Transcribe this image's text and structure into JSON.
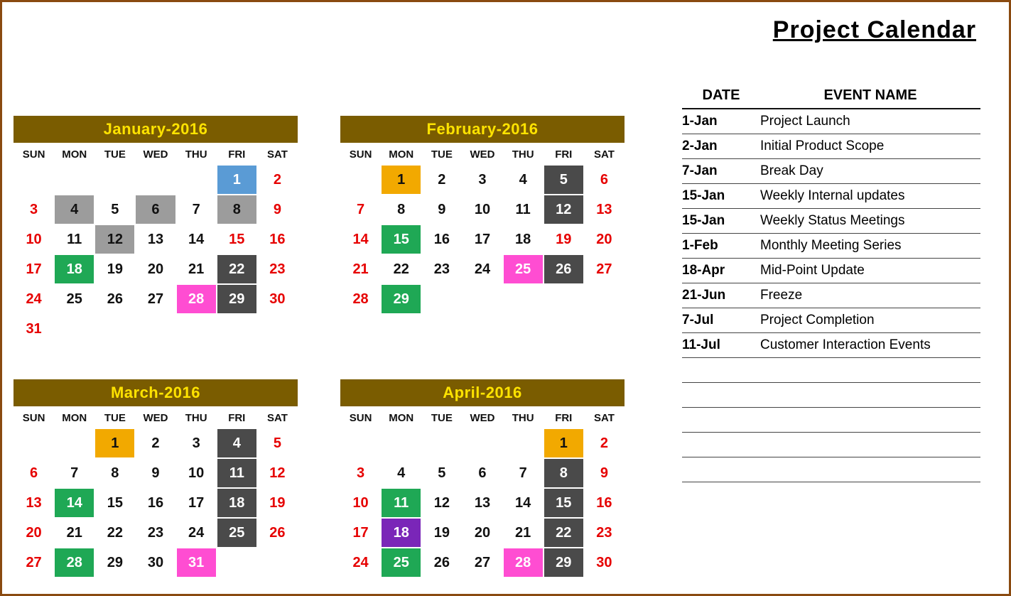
{
  "title": "Project Calendar",
  "dow": [
    "SUN",
    "MON",
    "TUE",
    "WED",
    "THU",
    "FRI",
    "SAT"
  ],
  "months": [
    {
      "title": "January-2016",
      "startDow": 5,
      "days": [
        {
          "n": 1,
          "c": "hl-blue"
        },
        {
          "n": 2,
          "c": "red"
        },
        {
          "n": 3,
          "c": "red"
        },
        {
          "n": 4,
          "c": "hl-grey"
        },
        {
          "n": 5
        },
        {
          "n": 6,
          "c": "hl-grey"
        },
        {
          "n": 7
        },
        {
          "n": 8,
          "c": "hl-grey"
        },
        {
          "n": 9,
          "c": "red"
        },
        {
          "n": 10,
          "c": "red"
        },
        {
          "n": 11
        },
        {
          "n": 12,
          "c": "hl-grey"
        },
        {
          "n": 13
        },
        {
          "n": 14
        },
        {
          "n": 15,
          "c": "red"
        },
        {
          "n": 16,
          "c": "red"
        },
        {
          "n": 17,
          "c": "red"
        },
        {
          "n": 18,
          "c": "hl-green"
        },
        {
          "n": 19
        },
        {
          "n": 20
        },
        {
          "n": 21
        },
        {
          "n": 22,
          "c": "hl-dark"
        },
        {
          "n": 23,
          "c": "red"
        },
        {
          "n": 24,
          "c": "red"
        },
        {
          "n": 25
        },
        {
          "n": 26
        },
        {
          "n": 27
        },
        {
          "n": 28,
          "c": "hl-pink"
        },
        {
          "n": 29,
          "c": "hl-dark"
        },
        {
          "n": 30,
          "c": "red"
        },
        {
          "n": 31,
          "c": "red"
        }
      ]
    },
    {
      "title": "February-2016",
      "startDow": 1,
      "days": [
        {
          "n": 1,
          "c": "hl-orange"
        },
        {
          "n": 2
        },
        {
          "n": 3
        },
        {
          "n": 4
        },
        {
          "n": 5,
          "c": "hl-dark"
        },
        {
          "n": 6,
          "c": "red"
        },
        {
          "n": 7,
          "c": "red"
        },
        {
          "n": 8
        },
        {
          "n": 9
        },
        {
          "n": 10
        },
        {
          "n": 11
        },
        {
          "n": 12,
          "c": "hl-dark"
        },
        {
          "n": 13,
          "c": "red"
        },
        {
          "n": 14,
          "c": "red"
        },
        {
          "n": 15,
          "c": "hl-green"
        },
        {
          "n": 16
        },
        {
          "n": 17
        },
        {
          "n": 18
        },
        {
          "n": 19,
          "c": "red"
        },
        {
          "n": 20,
          "c": "red"
        },
        {
          "n": 21,
          "c": "red"
        },
        {
          "n": 22
        },
        {
          "n": 23
        },
        {
          "n": 24
        },
        {
          "n": 25,
          "c": "hl-pink"
        },
        {
          "n": 26,
          "c": "hl-dark"
        },
        {
          "n": 27,
          "c": "red"
        },
        {
          "n": 28,
          "c": "red"
        },
        {
          "n": 29,
          "c": "hl-green"
        }
      ]
    },
    {
      "title": "March-2016",
      "startDow": 2,
      "days": [
        {
          "n": 1,
          "c": "hl-orange"
        },
        {
          "n": 2
        },
        {
          "n": 3
        },
        {
          "n": 4,
          "c": "hl-dark"
        },
        {
          "n": 5,
          "c": "red"
        },
        {
          "n": 6,
          "c": "red"
        },
        {
          "n": 7
        },
        {
          "n": 8
        },
        {
          "n": 9
        },
        {
          "n": 10
        },
        {
          "n": 11,
          "c": "hl-dark"
        },
        {
          "n": 12,
          "c": "red"
        },
        {
          "n": 13,
          "c": "red"
        },
        {
          "n": 14,
          "c": "hl-green"
        },
        {
          "n": 15
        },
        {
          "n": 16
        },
        {
          "n": 17
        },
        {
          "n": 18,
          "c": "hl-dark"
        },
        {
          "n": 19,
          "c": "red"
        },
        {
          "n": 20,
          "c": "red"
        },
        {
          "n": 21
        },
        {
          "n": 22
        },
        {
          "n": 23
        },
        {
          "n": 24
        },
        {
          "n": 25,
          "c": "hl-dark"
        },
        {
          "n": 26,
          "c": "red"
        },
        {
          "n": 27,
          "c": "red"
        },
        {
          "n": 28,
          "c": "hl-green"
        },
        {
          "n": 29
        },
        {
          "n": 30
        },
        {
          "n": 31,
          "c": "hl-pink"
        }
      ]
    },
    {
      "title": "April-2016",
      "startDow": 5,
      "days": [
        {
          "n": 1,
          "c": "hl-orange"
        },
        {
          "n": 2,
          "c": "red"
        },
        {
          "n": 3,
          "c": "red"
        },
        {
          "n": 4
        },
        {
          "n": 5
        },
        {
          "n": 6
        },
        {
          "n": 7
        },
        {
          "n": 8,
          "c": "hl-dark"
        },
        {
          "n": 9,
          "c": "red"
        },
        {
          "n": 10,
          "c": "red"
        },
        {
          "n": 11,
          "c": "hl-green"
        },
        {
          "n": 12
        },
        {
          "n": 13
        },
        {
          "n": 14
        },
        {
          "n": 15,
          "c": "hl-dark"
        },
        {
          "n": 16,
          "c": "red"
        },
        {
          "n": 17,
          "c": "red"
        },
        {
          "n": 18,
          "c": "hl-purple"
        },
        {
          "n": 19
        },
        {
          "n": 20
        },
        {
          "n": 21
        },
        {
          "n": 22,
          "c": "hl-dark"
        },
        {
          "n": 23,
          "c": "red"
        },
        {
          "n": 24,
          "c": "red"
        },
        {
          "n": 25,
          "c": "hl-green"
        },
        {
          "n": 26
        },
        {
          "n": 27
        },
        {
          "n": 28,
          "c": "hl-pink"
        },
        {
          "n": 29,
          "c": "hl-dark"
        },
        {
          "n": 30,
          "c": "red"
        }
      ]
    }
  ],
  "eventsHeader": {
    "date": "DATE",
    "event": "EVENT NAME"
  },
  "events": [
    {
      "date": "1-Jan",
      "name": "Project Launch"
    },
    {
      "date": "2-Jan",
      "name": "Initial Product Scope"
    },
    {
      "date": "7-Jan",
      "name": "Break Day"
    },
    {
      "date": "15-Jan",
      "name": "Weekly Internal updates"
    },
    {
      "date": "15-Jan",
      "name": "Weekly Status Meetings"
    },
    {
      "date": "1-Feb",
      "name": "Monthly Meeting Series"
    },
    {
      "date": "18-Apr",
      "name": "Mid-Point Update"
    },
    {
      "date": "21-Jun",
      "name": "Freeze"
    },
    {
      "date": "7-Jul",
      "name": "Project Completion"
    },
    {
      "date": "11-Jul",
      "name": "Customer Interaction Events"
    }
  ],
  "blankEventRows": 5
}
